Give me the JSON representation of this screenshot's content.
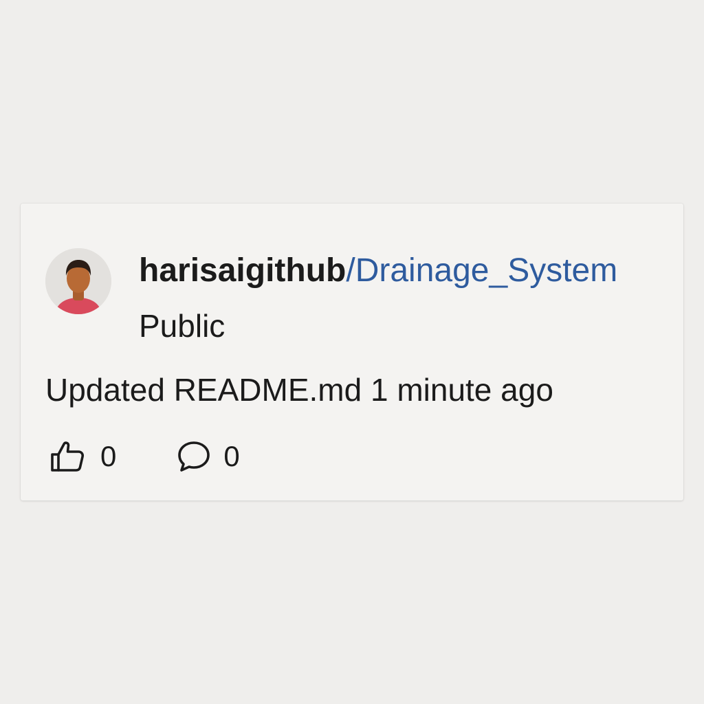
{
  "post": {
    "owner": "harisaigithub",
    "separator": "/",
    "repo": "Drainage_System",
    "visibility": "Public",
    "activity": "Updated README.md 1 minute ago"
  },
  "actions": {
    "likes": "0",
    "comments": "0"
  },
  "icons": {
    "like": "thumbs-up-icon",
    "comment": "comment-bubble-icon"
  },
  "colors": {
    "background": "#efeeec",
    "card": "#f4f3f1",
    "text": "#1b1b1b",
    "repo_link": "#2e5b9e",
    "avatar_shirt": "#d94a5c",
    "avatar_skin": "#b86a35"
  }
}
